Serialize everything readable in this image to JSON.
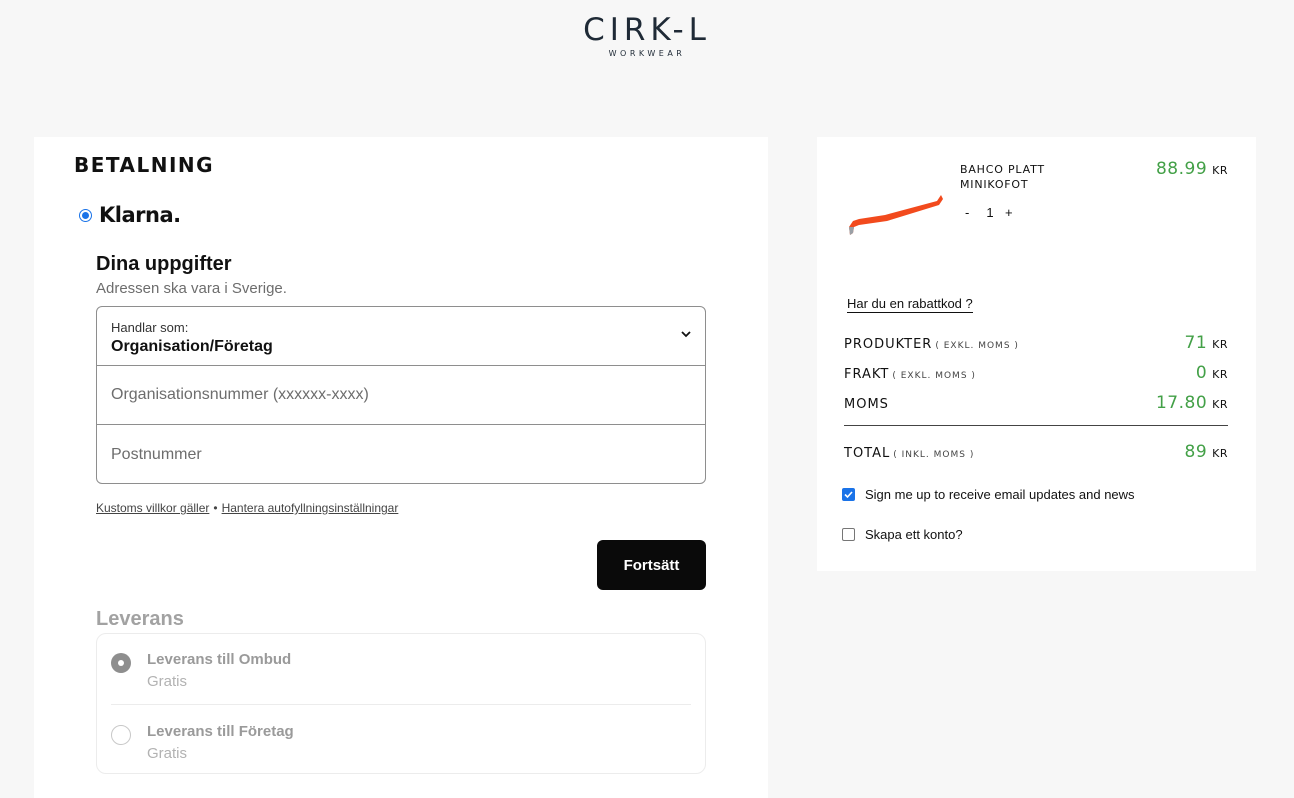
{
  "header": {
    "logo_main": "CIRK-L",
    "logo_sub": "WORKWEAR"
  },
  "checkout": {
    "section_title": "BETALNING",
    "payment_method": "Klarna.",
    "info_title": "Dina uppgifter",
    "info_subtitle": "Adressen ska vara i Sverige.",
    "customer_type": {
      "label": "Handlar som:",
      "value": "Organisation/Företag"
    },
    "org_number_placeholder": "Organisationsnummer (xxxxxx-xxxx)",
    "postal_code_placeholder": "Postnummer",
    "terms_link": "Kustoms villkor gäller",
    "terms_separator": "•",
    "autofill_link": "Hantera autofyllningsinställningar",
    "continue_label": "Fortsätt",
    "delivery_title": "Leverans",
    "delivery_options": [
      {
        "name": "Leverans till Ombud",
        "price": "Gratis",
        "selected": true
      },
      {
        "name": "Leverans till Företag",
        "price": "Gratis",
        "selected": false
      }
    ]
  },
  "cart": {
    "product": {
      "name": "BAHCO PLATT MINIKOFOT",
      "qty_minus": "-",
      "quantity": "1",
      "qty_plus": "+",
      "price": "88.99",
      "currency": "KR"
    },
    "discount_link": "Har du en rabattkod ?",
    "summary": {
      "products_label": "PRODUKTER",
      "products_note": "( EXKL. MOMS )",
      "products_value": "71",
      "shipping_label": "FRAKT",
      "shipping_note": "( EXKL. MOMS )",
      "shipping_value": "0",
      "vat_label": "MOMS",
      "vat_value": "17.80",
      "total_label": "TOTAL",
      "total_note": "( INKL. MOMS )",
      "total_value": "89",
      "currency": "KR"
    },
    "newsletter_label": "Sign me up to receive email updates and news",
    "newsletter_checked": true,
    "create_account_label": "Skapa ett konto?",
    "create_account_checked": false
  },
  "colors": {
    "price_green": "#43a047",
    "accent_blue": "#1a73e8",
    "button_black": "#0a0a0a",
    "product_orange": "#f24a1d"
  }
}
